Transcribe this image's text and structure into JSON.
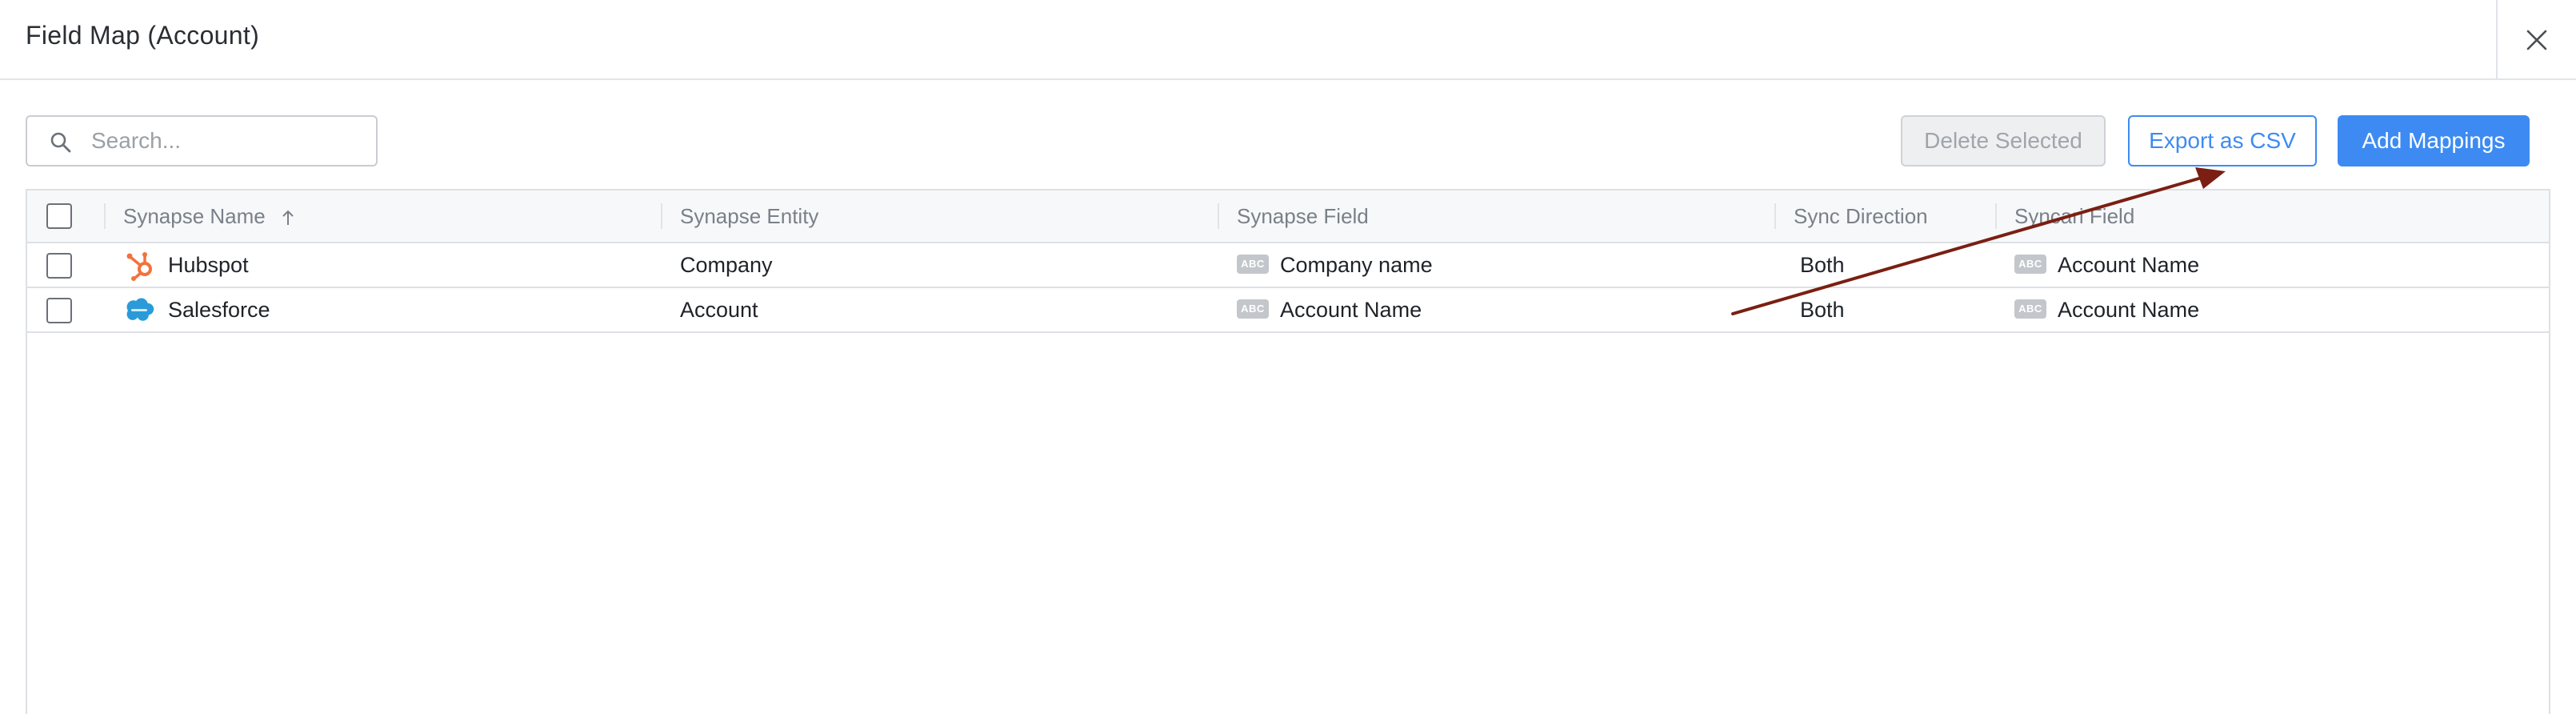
{
  "header": {
    "title": "Field Map (Account)",
    "close_icon": "close-icon"
  },
  "toolbar": {
    "search_placeholder": "Search...",
    "search_icon": "search-icon",
    "delete_label": "Delete Selected",
    "export_label": "Export as CSV",
    "add_label": "Add Mappings"
  },
  "table": {
    "columns": [
      {
        "label": "Synapse Name"
      },
      {
        "label": "Synapse Entity"
      },
      {
        "label": "Synapse Field"
      },
      {
        "label": "Sync Direction"
      },
      {
        "label": "Syncari Field"
      }
    ],
    "rows": [
      {
        "name": "Hubspot",
        "logo_icon": "hubspot-logo-icon",
        "entity": "Company",
        "field_type": "ABC",
        "field": "Company name",
        "direction": "Both",
        "syncari_type": "ABC",
        "syncari_field": "Account Name"
      },
      {
        "name": "Salesforce",
        "logo_icon": "salesforce-logo-icon",
        "entity": "Account",
        "field_type": "ABC",
        "field": "Account Name",
        "direction": "Both",
        "syncari_type": "ABC",
        "syncari_field": "Account Name"
      }
    ]
  },
  "colors": {
    "primary": "#3d8bf2",
    "annotation_arrow": "#7a1f12",
    "hubspot": "#f2723d",
    "salesforce": "#2a9bd8"
  }
}
